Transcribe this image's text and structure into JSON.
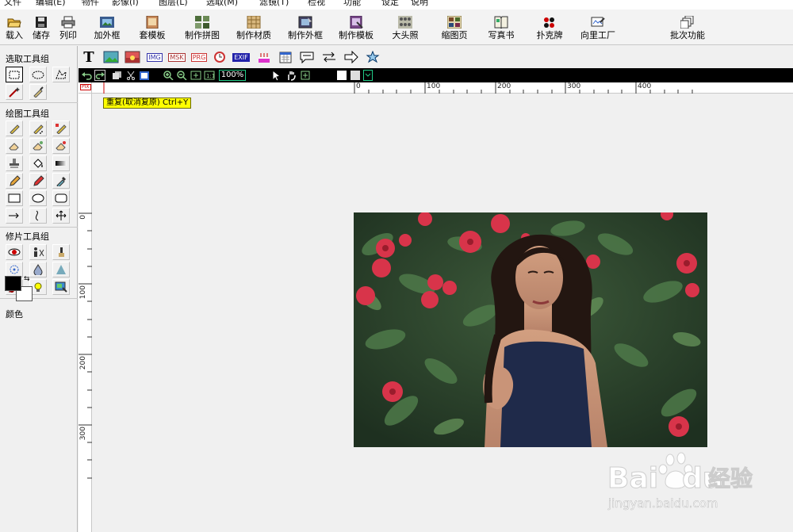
{
  "menu": [
    "文件",
    "编辑(E)",
    "物件",
    "影像(I)",
    "图层(L)",
    "选取(M)",
    "滤镜(T)",
    "检视",
    "功能",
    "设定",
    "说明"
  ],
  "toolbar": {
    "load": "载入",
    "save": "储存",
    "print": "列印",
    "add_frame": "加外框",
    "template": "套模板",
    "collage": "制作拼图",
    "material": "制作材质",
    "make_frame": "制作外框",
    "make_template": "制作模板",
    "headshot": "大头照",
    "thumbnail": "缩图页",
    "photo_book": "写真书",
    "poker": "扑克牌",
    "wizard": "向里工厂",
    "batch": "批次功能"
  },
  "panel": {
    "select_group": "选取工具组",
    "draw_group": "绘图工具组",
    "retouch_group": "修片工具组",
    "color": "颜色"
  },
  "subtoolbar": {
    "text_tool": "T",
    "img_label": "IMG",
    "msk_label": "MSK",
    "prg_label": "PRG",
    "exif_label": "EXIF"
  },
  "blackbar": {
    "zoom": "100%"
  },
  "tooltip": "重复(取消复原)  Ctrl+Y",
  "ruler": {
    "h": [
      "0",
      "100",
      "200",
      "300",
      "400"
    ],
    "v": [
      "0",
      "100",
      "200",
      "300"
    ]
  },
  "colors": {
    "foreground": "#000000",
    "background": "#ffffff"
  },
  "watermark": {
    "brand": "Bai",
    "brand2": "du",
    "cn": "经验",
    "url": "jingyan.baidu.com"
  }
}
